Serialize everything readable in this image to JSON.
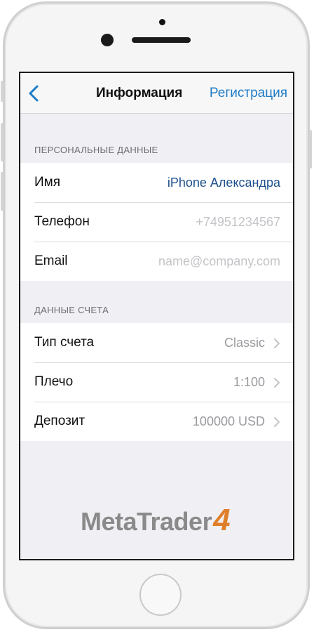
{
  "nav": {
    "back_icon": "chevron-left-icon",
    "title": "Информация",
    "action": "Регистрация"
  },
  "personal": {
    "header": "ПЕРСОНАЛЬНЫЕ ДАННЫЕ",
    "rows": [
      {
        "label": "Имя",
        "value": "iPhone Александра"
      },
      {
        "label": "Телефон",
        "placeholder": "+74951234567"
      },
      {
        "label": "Email",
        "placeholder": "name@company.com"
      }
    ]
  },
  "account": {
    "header": "ДАННЫЕ СЧЕТА",
    "rows": [
      {
        "label": "Тип счета",
        "value": "Classic"
      },
      {
        "label": "Плечо",
        "value": "1:100"
      },
      {
        "label": "Депозит",
        "value": "100000 USD"
      }
    ]
  },
  "logo": {
    "text": "MetaTrader",
    "number": "4"
  },
  "colors": {
    "accent": "#1f7cc7",
    "brand_orange": "#e07f2a",
    "background": "#efeff4"
  }
}
